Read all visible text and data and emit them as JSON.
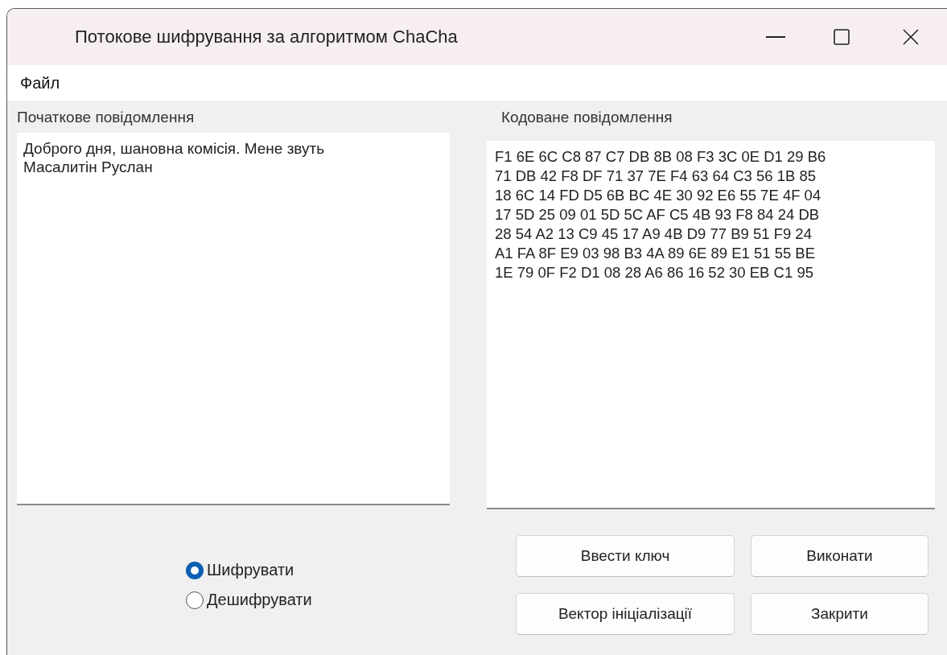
{
  "window": {
    "title": "Потокове шифрування за алгоритмом ChaCha"
  },
  "menu": [
    "Файл"
  ],
  "source": {
    "label": "Початкове повідомлення",
    "value": "Доброго дня, шановна комісія. Мене звуть Масалитін Руслан"
  },
  "encoded": {
    "label": "Кодоване повідомлення",
    "value": "F1 6E 6C C8 87 C7 DB 8B 08 F3 3C 0E D1 29 B6\n71 DB 42 F8 DF 71 37 7E F4 63 64 C3 56 1B 85\n18 6C 14 FD D5 6B BC 4E 30 92 E6 55 7E 4F 04\n17 5D 25 09 01 5D 5C AF C5 4B 93 F8 84 24 DB\n28 54 A2 13 C9 45 17 A9 4B D9 77 B9 51 F9 24\nA1 FA 8F E9 03 98 B3 4A 89 6E 89 E1 51 55 BE\n1E 79 0F F2 D1 08 28 A6 86 16 52 30 EB C1 95"
  },
  "modes": [
    {
      "label": "Шифрувати",
      "selected": true
    },
    {
      "label": "Дешифрувати",
      "selected": false
    }
  ],
  "buttons": [
    "Ввести ключ",
    "Виконати",
    "Вектор ініціалізації",
    "Закрити"
  ]
}
